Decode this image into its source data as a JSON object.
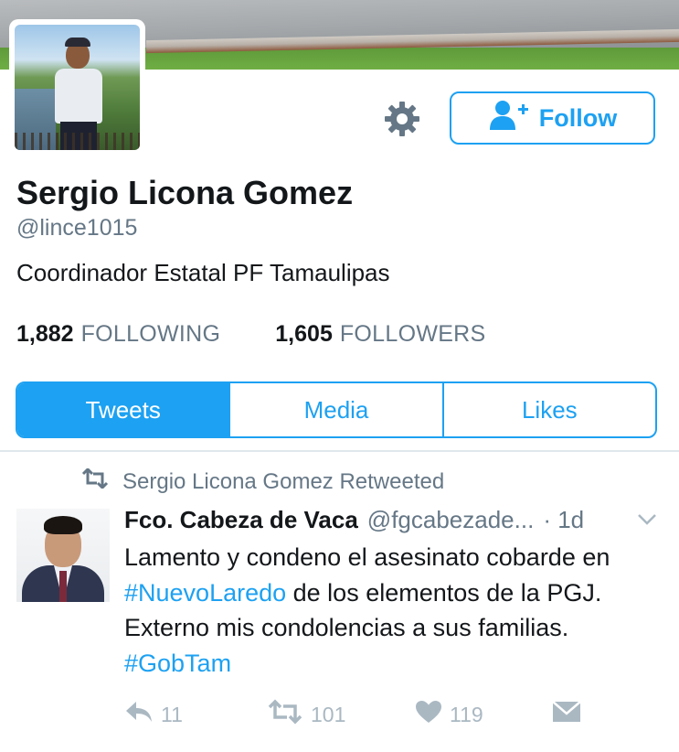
{
  "profile": {
    "name": "Sergio Licona Gomez",
    "handle": "@lince1015",
    "bio": "Coordinador Estatal PF Tamaulipas",
    "follow_label": "Follow"
  },
  "stats": {
    "following_count": "1,882",
    "following_label": "FOLLOWING",
    "followers_count": "1,605",
    "followers_label": "FOLLOWERS"
  },
  "tabs": [
    {
      "label": "Tweets",
      "active": true
    },
    {
      "label": "Media",
      "active": false
    },
    {
      "label": "Likes",
      "active": false
    }
  ],
  "tweet": {
    "retweet_note": "Sergio Licona Gomez Retweeted",
    "author_name": "Fco. Cabeza de Vaca",
    "author_handle": "@fgcabezade...",
    "time": "· 1d",
    "text_1": "Lamento y condeno el asesinato cobarde en ",
    "hashtag_1": "#NuevoLaredo",
    "text_2": " de los elementos de la PGJ. Externo mis condolencias a sus familias. ",
    "hashtag_2": "#GobTam",
    "reply_count": "11",
    "retweet_count": "101",
    "like_count": "119"
  },
  "colors": {
    "accent": "#1da1f2",
    "muted": "#657786",
    "icon_gray": "#aab8c2"
  },
  "icons": {
    "settings": "gear-icon",
    "follow": "add-user-icon",
    "retweeted": "retweet-icon",
    "menu": "chevron-down-icon",
    "reply": "reply-icon",
    "retweet": "retweet-icon",
    "like": "heart-icon",
    "dm": "envelope-icon"
  }
}
